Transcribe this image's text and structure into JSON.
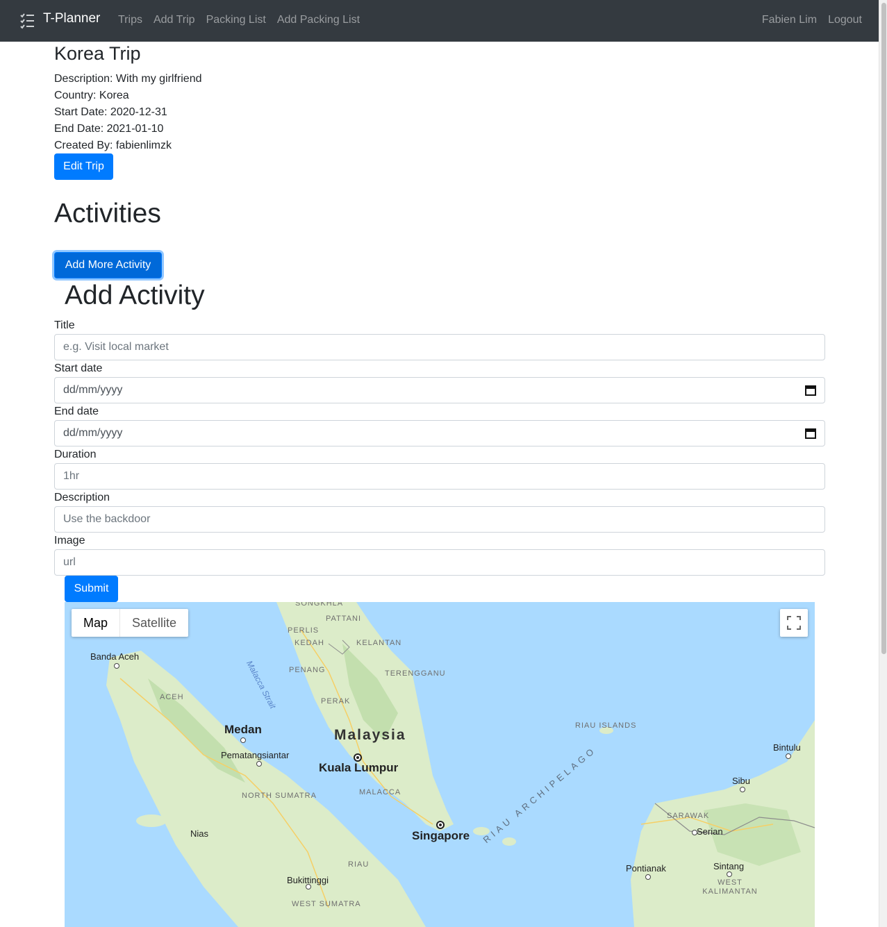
{
  "navbar": {
    "brand": "T-Planner",
    "brand_icon": "checklist-icon",
    "links": [
      "Trips",
      "Add Trip",
      "Packing List",
      "Add Packing List"
    ],
    "user": "Fabien Lim",
    "logout": "Logout"
  },
  "trip": {
    "title": "Korea Trip",
    "description": "Description: With my girlfriend",
    "country": "Country: Korea",
    "start_date": "Start Date: 2020-12-31",
    "end_date": "End Date: 2021-01-10",
    "created_by": "Created By: fabienlimzk",
    "edit_label": "Edit Trip"
  },
  "activities": {
    "heading": "Activities",
    "add_more_label": "Add More Activity"
  },
  "form": {
    "heading": "Add Activity",
    "title_label": "Title",
    "title_placeholder": "e.g. Visit local market",
    "start_label": "Start date",
    "start_placeholder": "dd/mm/yyyy",
    "end_label": "End date",
    "end_placeholder": "dd/mm/yyyy",
    "duration_label": "Duration",
    "duration_placeholder": "1hr",
    "description_label": "Description",
    "description_placeholder": "Use the backdoor",
    "image_label": "Image",
    "image_placeholder": "url",
    "submit_label": "Submit"
  },
  "map": {
    "type_map": "Map",
    "type_satellite": "Satellite",
    "labels": {
      "songkhla": "SONGKHLA",
      "pattani": "PATTANI",
      "perlis": "PERLIS",
      "kedah": "KEDAH",
      "kelantan": "KELANTAN",
      "banda_aceh": "Banda Aceh",
      "malacca_strait": "Malacca Strait",
      "penang": "PENANG",
      "terengganu": "TERENGGANU",
      "aceh": "ACEH",
      "perak": "PERAK",
      "medan": "Medan",
      "malaysia": "Malaysia",
      "riau_islands": "RIAU ISLANDS",
      "pematangsiantar": "Pematangsiantar",
      "kuala_lumpur": "Kuala Lumpur",
      "bintulu": "Bintulu",
      "riau_archipelago": "RIAU ARCHIPELAGO",
      "north_sumatra": "NORTH SUMATRA",
      "malacca": "MALACCA",
      "sibu": "Sibu",
      "sarawak": "SARAWAK",
      "serian": "Serian",
      "singapore": "Singapore",
      "nias": "Nias",
      "pontianak": "Pontianak",
      "sintang": "Sintang",
      "riau": "RIAU",
      "west_kalimantan": "WEST KALIMANTAN",
      "bukittinggi": "Bukittinggi",
      "west_sumatra": "WEST SUMATRA"
    }
  },
  "colors": {
    "navbar_bg": "#343a40",
    "primary": "#007bff",
    "water": "#aadaff",
    "land": "#dcecc9"
  }
}
